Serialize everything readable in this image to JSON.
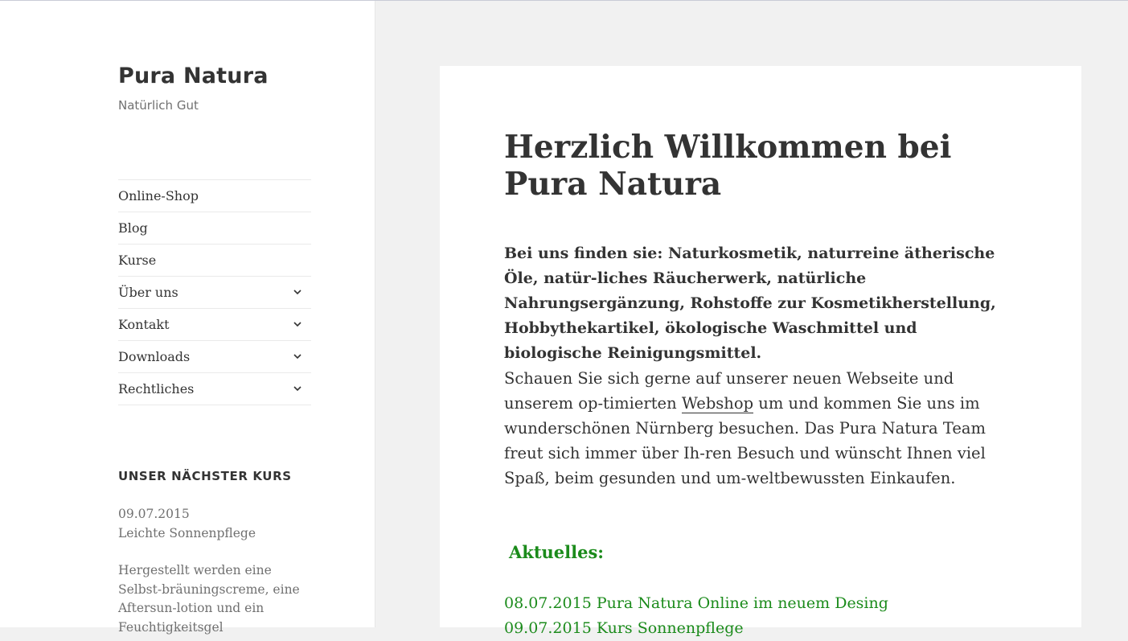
{
  "site": {
    "title": "Pura Natura",
    "tagline": "Natürlich Gut"
  },
  "nav": {
    "items": [
      {
        "label": "Online-Shop",
        "has_submenu": false
      },
      {
        "label": "Blog",
        "has_submenu": false
      },
      {
        "label": "Kurse",
        "has_submenu": false
      },
      {
        "label": "Über uns",
        "has_submenu": true
      },
      {
        "label": "Kontakt",
        "has_submenu": true
      },
      {
        "label": "Downloads",
        "has_submenu": true
      },
      {
        "label": "Rechtliches",
        "has_submenu": true
      }
    ],
    "submenu_icon": "chevron-down-icon"
  },
  "widget": {
    "title": "UNSER NÄCHSTER KURS",
    "date": "09.07.2015",
    "course": "Leichte Sonnenpflege",
    "description": "Hergestellt werden eine Selbst-bräuningscreme, eine Aftersun-lotion und ein Feuchtigkeitsgel"
  },
  "main": {
    "title": "Herzlich Willkommen bei Pura Natura",
    "lead": "Bei uns finden sie: Naturkosmetik, naturreine ätherische Öle, natür-liches Räucherwerk, natürliche Nahrungsergänzung, Rohstoffe zur Kosmetikherstellung, Hobbythekartikel, ökologische Waschmittel und biologische Reinigungsmittel.",
    "paragraph_before_link": "Schauen Sie sich gerne auf unserer neuen Webseite und unserem op-timierten ",
    "link_text": "Webshop",
    "paragraph_after_link": " um und kommen Sie uns im wunderschönen Nürnberg besuchen. Das Pura Natura Team freut sich immer über Ih-ren Besuch und wünscht Ihnen viel Spaß, beim gesunden und um-weltbewussten Einkaufen.",
    "news_heading": "Aktuelles:",
    "news": [
      {
        "text": "08.07.2015 Pura Natura Online im neuem Desing"
      },
      {
        "text": "09.07.2015 Kurs Sonnenpflege"
      }
    ]
  },
  "colors": {
    "accent_green": "#1b8b1b",
    "text": "#333333",
    "muted": "#707070",
    "page_bg": "#f1f1f1"
  }
}
